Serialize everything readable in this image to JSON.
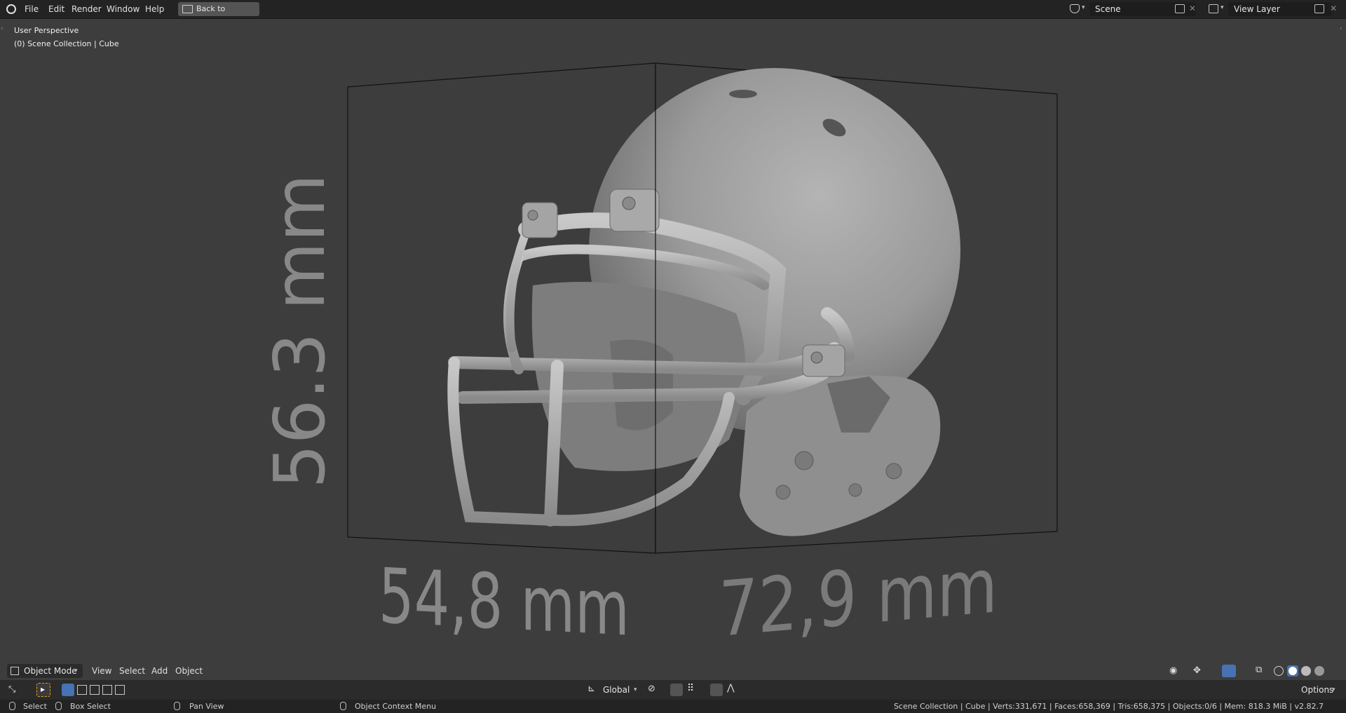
{
  "app": {
    "menu": [
      "File",
      "Edit",
      "Render",
      "Window",
      "Help"
    ],
    "back_button": "Back to Previous",
    "scene_name": "Scene",
    "view_layer": "View Layer"
  },
  "viewport": {
    "perspective": "User Perspective",
    "collection_path": "(0) Scene Collection | Cube",
    "dimension_height": "56.3 mm",
    "dimension_width": "54,8 mm",
    "dimension_depth": "72,9 mm"
  },
  "header": {
    "mode": "Object Mode",
    "menus": [
      "View",
      "Select",
      "Add",
      "Object"
    ],
    "orientation": "Global",
    "options": "Options"
  },
  "status": {
    "select": "Select",
    "box_select": "Box Select",
    "pan_view": "Pan View",
    "context_menu": "Object Context Menu",
    "stats": "Scene Collection | Cube | Verts:331,671 | Faces:658,369 | Tris:658,375 | Objects:0/6 | Mem: 818.3 MiB | v2.82.7"
  },
  "colors": {
    "viewport_bg": "#3d3d3d",
    "topbar_bg": "#232323",
    "accent": "#4772b3"
  }
}
